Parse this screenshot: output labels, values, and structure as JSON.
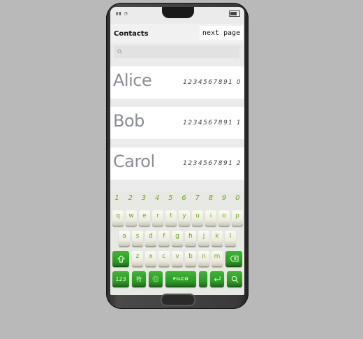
{
  "header": {
    "title": "Contacts",
    "next_label": "next page"
  },
  "search": {
    "placeholder": ""
  },
  "contacts": [
    {
      "name": "Alice",
      "phone": "1234567891 0"
    },
    {
      "name": "Bob",
      "phone": "1234567891 1"
    },
    {
      "name": "Carol",
      "phone": "1234567891 2"
    }
  ],
  "keyboard": {
    "numbers": [
      "1",
      "2",
      "3",
      "4",
      "5",
      "6",
      "7",
      "8",
      "9",
      "0"
    ],
    "row1": [
      "q",
      "w",
      "e",
      "r",
      "t",
      "y",
      "u",
      "i",
      "o",
      "p"
    ],
    "row2": [
      "a",
      "s",
      "d",
      "f",
      "g",
      "h",
      "j",
      "k",
      "l"
    ],
    "row3": [
      "z",
      "x",
      "c",
      "v",
      "b",
      "n",
      "m"
    ],
    "num_key": "123",
    "symbol_key": "符",
    "space_label": "FILCO"
  },
  "colors": {
    "key_green": "#2b9a22",
    "key_label_green": "#6aa81c",
    "name_gray": "#8b8d96"
  }
}
